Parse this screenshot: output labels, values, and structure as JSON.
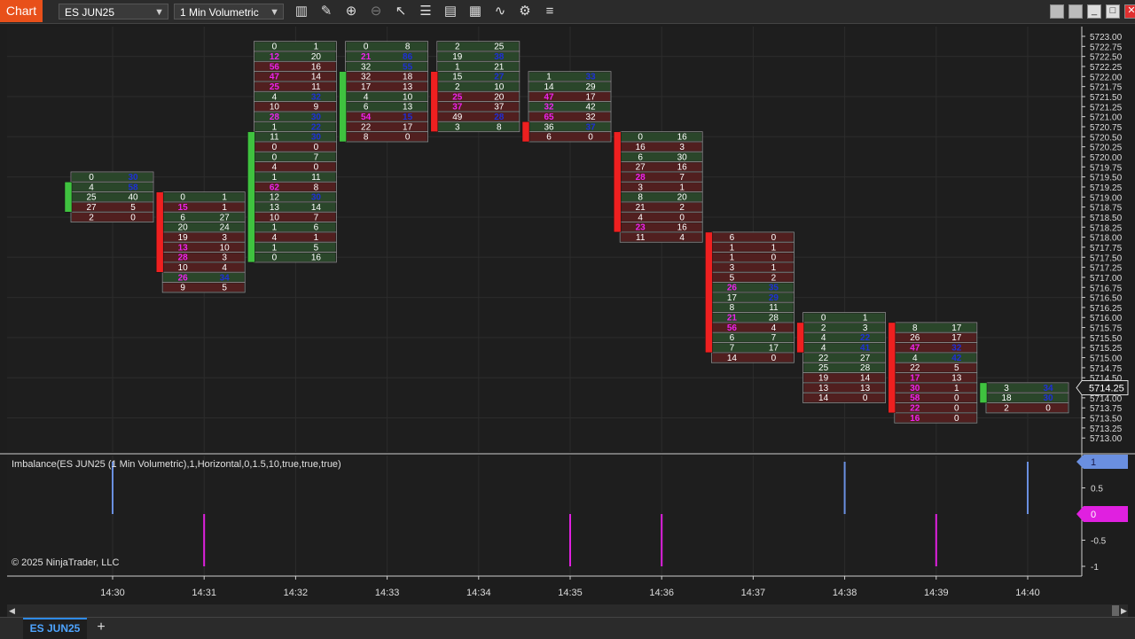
{
  "toolbar": {
    "chart_tab": "Chart",
    "instrument": "ES JUN25",
    "interval": "1 Min Volumetric",
    "icons": [
      "bars-type-icon",
      "draw-icon",
      "zoom-in-icon",
      "zoom-out-icon",
      "pointer-icon",
      "properties-icon",
      "templates-icon",
      "data-series-icon",
      "indicators-icon",
      "strategies-icon",
      "more-icon"
    ],
    "window_buttons": [
      "tile-icon",
      "restore-small-icon",
      "minimize-icon",
      "maximize-icon",
      "close-icon"
    ]
  },
  "price_axis": {
    "labels": [
      "5723.00",
      "5722.75",
      "5722.50",
      "5722.25",
      "5722.00",
      "5721.75",
      "5721.50",
      "5721.25",
      "5721.00",
      "5720.75",
      "5720.50",
      "5720.25",
      "5720.00",
      "5719.75",
      "5719.50",
      "5719.25",
      "5719.00",
      "5718.75",
      "5718.50",
      "5718.25",
      "5718.00",
      "5717.75",
      "5717.50",
      "5717.25",
      "5717.00",
      "5716.75",
      "5716.50",
      "5716.25",
      "5716.00",
      "5715.75",
      "5715.50",
      "5715.25",
      "5715.00",
      "5714.75",
      "5714.50",
      "5714.25",
      "5714.00",
      "5713.75",
      "5713.50",
      "5713.25",
      "5713.00"
    ],
    "last_price": "5714.25"
  },
  "indicator": {
    "label": "Imbalance(ES JUN25 (1 Min Volumetric),1,Horizontal,0,1.5,10,true,true,true)",
    "axis_labels": [
      "1",
      "0.5",
      "0",
      "-0.5",
      "-1"
    ],
    "marker_pos": "1",
    "marker_zero": "0",
    "colors": {
      "positive": "#6a8fe0",
      "negative": "#e020e0"
    }
  },
  "copyright": "© 2025 NinjaTrader, LLC",
  "time_axis": [
    "14:30",
    "14:31",
    "14:32",
    "14:33",
    "14:34",
    "14:35",
    "14:36",
    "14:37",
    "14:38",
    "14:39",
    "14:40"
  ],
  "tabs": {
    "active": "ES JUN25",
    "add": "+"
  },
  "colors": {
    "up": "#3fc23f",
    "down": "#ee2020",
    "bid_imb": "#ee22ee",
    "ask_imb": "#1f2fd8",
    "cell_green": "#2d4d2d",
    "cell_red": "#5a2020",
    "text": "#ffffff"
  },
  "chart_data": {
    "type": "footprint",
    "bars": [
      {
        "time": "14:30",
        "dir": "up",
        "open": 5718.75,
        "close": 5719.25,
        "top": 5719.5,
        "rows": [
          [
            0,
            30,
            "g",
            "",
            "a"
          ],
          [
            4,
            58,
            "g",
            "",
            "a"
          ],
          [
            25,
            40,
            "g",
            "",
            ""
          ],
          [
            27,
            5,
            "r",
            "",
            ""
          ],
          [
            2,
            0,
            "r",
            "",
            ""
          ]
        ]
      },
      {
        "time": "14:31",
        "dir": "down",
        "open": 5719.0,
        "close": 5717.25,
        "top": 5719.0,
        "rows": [
          [
            0,
            1,
            "g",
            "",
            ""
          ],
          [
            15,
            1,
            "r",
            "b",
            ""
          ],
          [
            6,
            27,
            "g",
            "",
            ""
          ],
          [
            20,
            24,
            "g",
            "",
            ""
          ],
          [
            19,
            3,
            "r",
            "",
            ""
          ],
          [
            13,
            10,
            "r",
            "b",
            ""
          ],
          [
            28,
            3,
            "r",
            "b",
            ""
          ],
          [
            10,
            4,
            "r",
            "",
            ""
          ],
          [
            26,
            34,
            "g",
            "b",
            "a"
          ],
          [
            9,
            5,
            "r",
            "",
            ""
          ]
        ]
      },
      {
        "time": "14:32",
        "dir": "up",
        "open": 5717.5,
        "close": 5720.5,
        "top": 5722.75,
        "rows": [
          [
            0,
            1,
            "g",
            "",
            ""
          ],
          [
            12,
            20,
            "g",
            "b",
            ""
          ],
          [
            56,
            16,
            "r",
            "b",
            ""
          ],
          [
            47,
            14,
            "r",
            "b",
            ""
          ],
          [
            25,
            11,
            "r",
            "b",
            ""
          ],
          [
            4,
            32,
            "g",
            "",
            "a"
          ],
          [
            10,
            9,
            "r",
            "",
            ""
          ],
          [
            28,
            30,
            "g",
            "b",
            "a"
          ],
          [
            1,
            22,
            "g",
            "",
            "a"
          ],
          [
            11,
            30,
            "g",
            "",
            "a"
          ],
          [
            0,
            0,
            "r",
            "",
            ""
          ],
          [
            0,
            7,
            "g",
            "",
            ""
          ],
          [
            4,
            0,
            "r",
            "",
            ""
          ],
          [
            1,
            11,
            "g",
            "",
            ""
          ],
          [
            62,
            8,
            "r",
            "b",
            ""
          ],
          [
            12,
            30,
            "g",
            "",
            "a"
          ],
          [
            13,
            14,
            "g",
            "",
            ""
          ],
          [
            10,
            7,
            "r",
            "",
            ""
          ],
          [
            1,
            6,
            "g",
            "",
            ""
          ],
          [
            4,
            1,
            "r",
            "",
            ""
          ],
          [
            1,
            5,
            "g",
            "",
            ""
          ],
          [
            0,
            16,
            "g",
            "",
            ""
          ]
        ]
      },
      {
        "time": "14:33",
        "dir": "up",
        "open": 5720.5,
        "close": 5722.0,
        "top": 5722.75,
        "rows": [
          [
            0,
            8,
            "g",
            "",
            ""
          ],
          [
            21,
            86,
            "g",
            "b",
            "a"
          ],
          [
            32,
            55,
            "g",
            "",
            "a"
          ],
          [
            32,
            18,
            "r",
            "",
            ""
          ],
          [
            17,
            13,
            "r",
            "",
            ""
          ],
          [
            4,
            10,
            "g",
            "",
            ""
          ],
          [
            6,
            13,
            "g",
            "",
            ""
          ],
          [
            54,
            15,
            "r",
            "b",
            "a"
          ],
          [
            22,
            17,
            "r",
            "",
            ""
          ],
          [
            8,
            0,
            "r",
            "",
            ""
          ]
        ]
      },
      {
        "time": "14:34",
        "dir": "down",
        "open": 5722.0,
        "close": 5720.75,
        "top": 5722.75,
        "rows": [
          [
            2,
            25,
            "g",
            "",
            ""
          ],
          [
            19,
            38,
            "g",
            "",
            "a"
          ],
          [
            1,
            21,
            "g",
            "",
            ""
          ],
          [
            15,
            27,
            "g",
            "",
            "a"
          ],
          [
            2,
            10,
            "g",
            "",
            ""
          ],
          [
            25,
            20,
            "r",
            "b",
            ""
          ],
          [
            37,
            37,
            "r",
            "b",
            ""
          ],
          [
            49,
            28,
            "r",
            "",
            "a"
          ],
          [
            3,
            8,
            "g",
            "",
            ""
          ]
        ]
      },
      {
        "time": "14:35",
        "dir": "down",
        "open": 5720.75,
        "close": 5720.5,
        "top": 5722.0,
        "rows": [
          [
            1,
            33,
            "g",
            "",
            "a"
          ],
          [
            14,
            29,
            "g",
            "",
            ""
          ],
          [
            47,
            17,
            "r",
            "b",
            ""
          ],
          [
            32,
            42,
            "g",
            "b",
            ""
          ],
          [
            65,
            32,
            "r",
            "b",
            ""
          ],
          [
            36,
            37,
            "g",
            "",
            "a"
          ],
          [
            6,
            0,
            "r",
            "",
            ""
          ]
        ]
      },
      {
        "time": "14:36",
        "dir": "down",
        "open": 5720.5,
        "close": 5718.25,
        "top": 5720.5,
        "rows": [
          [
            0,
            16,
            "g",
            "",
            ""
          ],
          [
            16,
            3,
            "r",
            "",
            ""
          ],
          [
            6,
            30,
            "g",
            "",
            ""
          ],
          [
            27,
            16,
            "r",
            "",
            ""
          ],
          [
            28,
            7,
            "r",
            "b",
            ""
          ],
          [
            3,
            1,
            "r",
            "",
            ""
          ],
          [
            8,
            20,
            "g",
            "",
            ""
          ],
          [
            21,
            2,
            "r",
            "",
            ""
          ],
          [
            4,
            0,
            "r",
            "",
            ""
          ],
          [
            23,
            16,
            "r",
            "b",
            ""
          ],
          [
            11,
            4,
            "r",
            "",
            ""
          ]
        ]
      },
      {
        "time": "14:37",
        "dir": "down",
        "open": 5718.0,
        "close": 5715.25,
        "top": 5718.0,
        "rows": [
          [
            6,
            0,
            "r",
            "",
            ""
          ],
          [
            1,
            1,
            "r",
            "",
            ""
          ],
          [
            1,
            0,
            "r",
            "",
            ""
          ],
          [
            3,
            1,
            "r",
            "",
            ""
          ],
          [
            5,
            2,
            "r",
            "",
            ""
          ],
          [
            26,
            35,
            "g",
            "b",
            "a"
          ],
          [
            17,
            29,
            "g",
            "",
            "a"
          ],
          [
            8,
            11,
            "g",
            "",
            ""
          ],
          [
            21,
            28,
            "g",
            "b",
            ""
          ],
          [
            56,
            4,
            "r",
            "b",
            ""
          ],
          [
            6,
            7,
            "g",
            "",
            ""
          ],
          [
            7,
            17,
            "g",
            "",
            ""
          ],
          [
            14,
            0,
            "r",
            "",
            ""
          ]
        ]
      },
      {
        "time": "14:38",
        "dir": "down",
        "open": 5715.75,
        "close": 5715.25,
        "top": 5716.0,
        "rows": [
          [
            0,
            1,
            "g",
            "",
            ""
          ],
          [
            2,
            3,
            "g",
            "",
            ""
          ],
          [
            4,
            22,
            "g",
            "",
            "a"
          ],
          [
            4,
            41,
            "g",
            "",
            "a"
          ],
          [
            22,
            27,
            "g",
            "",
            ""
          ],
          [
            25,
            28,
            "g",
            "",
            ""
          ],
          [
            19,
            14,
            "r",
            "",
            ""
          ],
          [
            13,
            13,
            "r",
            "",
            ""
          ],
          [
            14,
            0,
            "r",
            "",
            ""
          ]
        ]
      },
      {
        "time": "14:39",
        "dir": "down",
        "open": 5715.75,
        "close": 5713.75,
        "top": 5715.75,
        "rows": [
          [
            8,
            17,
            "g",
            "",
            ""
          ],
          [
            26,
            17,
            "r",
            "",
            ""
          ],
          [
            47,
            32,
            "r",
            "b",
            "a"
          ],
          [
            4,
            42,
            "g",
            "",
            "a"
          ],
          [
            22,
            5,
            "r",
            "",
            ""
          ],
          [
            17,
            13,
            "r",
            "b",
            ""
          ],
          [
            30,
            1,
            "r",
            "b",
            ""
          ],
          [
            58,
            0,
            "r",
            "b",
            ""
          ],
          [
            22,
            0,
            "r",
            "b",
            ""
          ],
          [
            16,
            0,
            "r",
            "b",
            ""
          ]
        ]
      },
      {
        "time": "14:40",
        "dir": "up",
        "open": 5714.0,
        "close": 5714.25,
        "top": 5714.25,
        "rows": [
          [
            3,
            34,
            "g",
            "",
            "a"
          ],
          [
            18,
            30,
            "g",
            "",
            "a"
          ],
          [
            2,
            0,
            "r",
            "",
            ""
          ]
        ]
      }
    ],
    "imbalance": [
      1,
      -1,
      0,
      0,
      0,
      -1,
      -1,
      0,
      1,
      -1,
      1
    ]
  }
}
